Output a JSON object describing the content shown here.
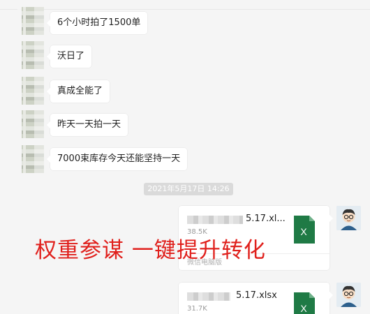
{
  "messages": [
    {
      "text": "6个小时拍了1500单"
    },
    {
      "text": "沃日了"
    },
    {
      "text": "真成全能了"
    },
    {
      "text": "昨天一天拍一天"
    },
    {
      "text": "7000束库存今天还能坚持一天"
    }
  ],
  "timestamp": "2021年5月17日 14:26",
  "files": [
    {
      "name": "5.17.xl...",
      "size": "38.5K",
      "source": "微信电脑版",
      "icon": "excel-icon"
    },
    {
      "name": "5.17.xlsx",
      "size": "31.7K",
      "icon": "excel-icon"
    }
  ],
  "overlay": {
    "text": "权重参谋  一键提升转化"
  },
  "colors": {
    "overlay": "#e0201c",
    "excel_green": "#1f7a45",
    "bubble": "#ffffff",
    "background": "#f5f5f5"
  }
}
